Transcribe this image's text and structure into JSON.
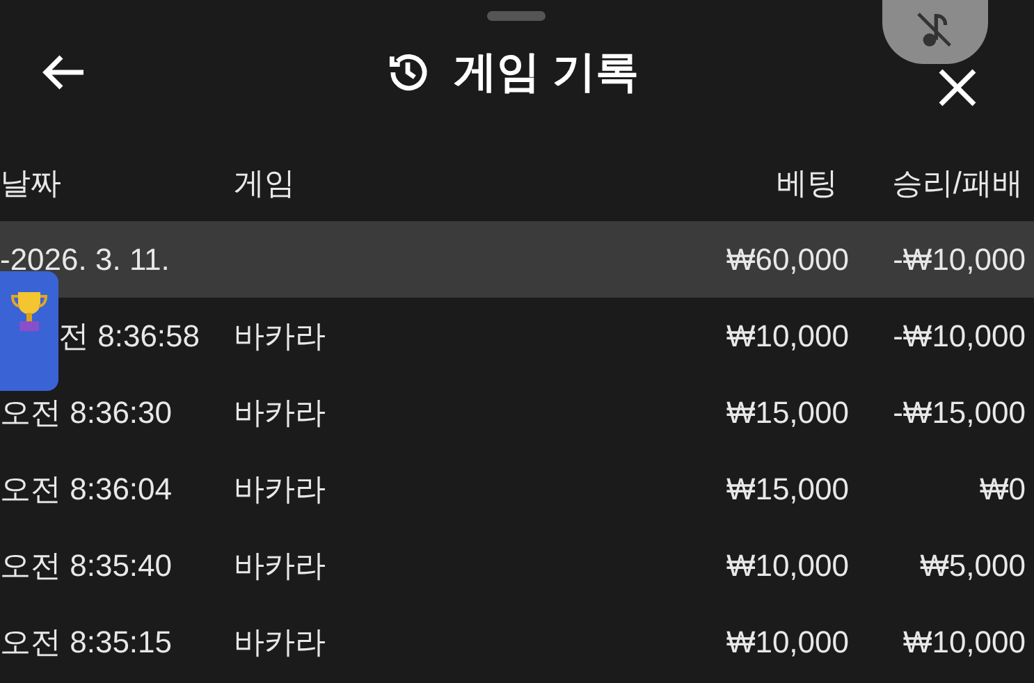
{
  "header": {
    "title": "게임 기록"
  },
  "table": {
    "columns": [
      "날짜",
      "게임",
      "베팅",
      "승리/패배"
    ],
    "group": {
      "date": "-2026. 3. 11.",
      "bet": "₩60,000",
      "result": "-₩10,000"
    },
    "rows": [
      {
        "time": "전 8:36:58",
        "game": "바카라",
        "bet": "₩10,000",
        "result": "-₩10,000"
      },
      {
        "time": "오전 8:36:30",
        "game": "바카라",
        "bet": "₩15,000",
        "result": "-₩15,000"
      },
      {
        "time": "오전 8:36:04",
        "game": "바카라",
        "bet": "₩15,000",
        "result": "₩0"
      },
      {
        "time": "오전 8:35:40",
        "game": "바카라",
        "bet": "₩10,000",
        "result": "₩5,000"
      },
      {
        "time": "오전 8:35:15",
        "game": "바카라",
        "bet": "₩10,000",
        "result": "₩10,000"
      }
    ]
  }
}
